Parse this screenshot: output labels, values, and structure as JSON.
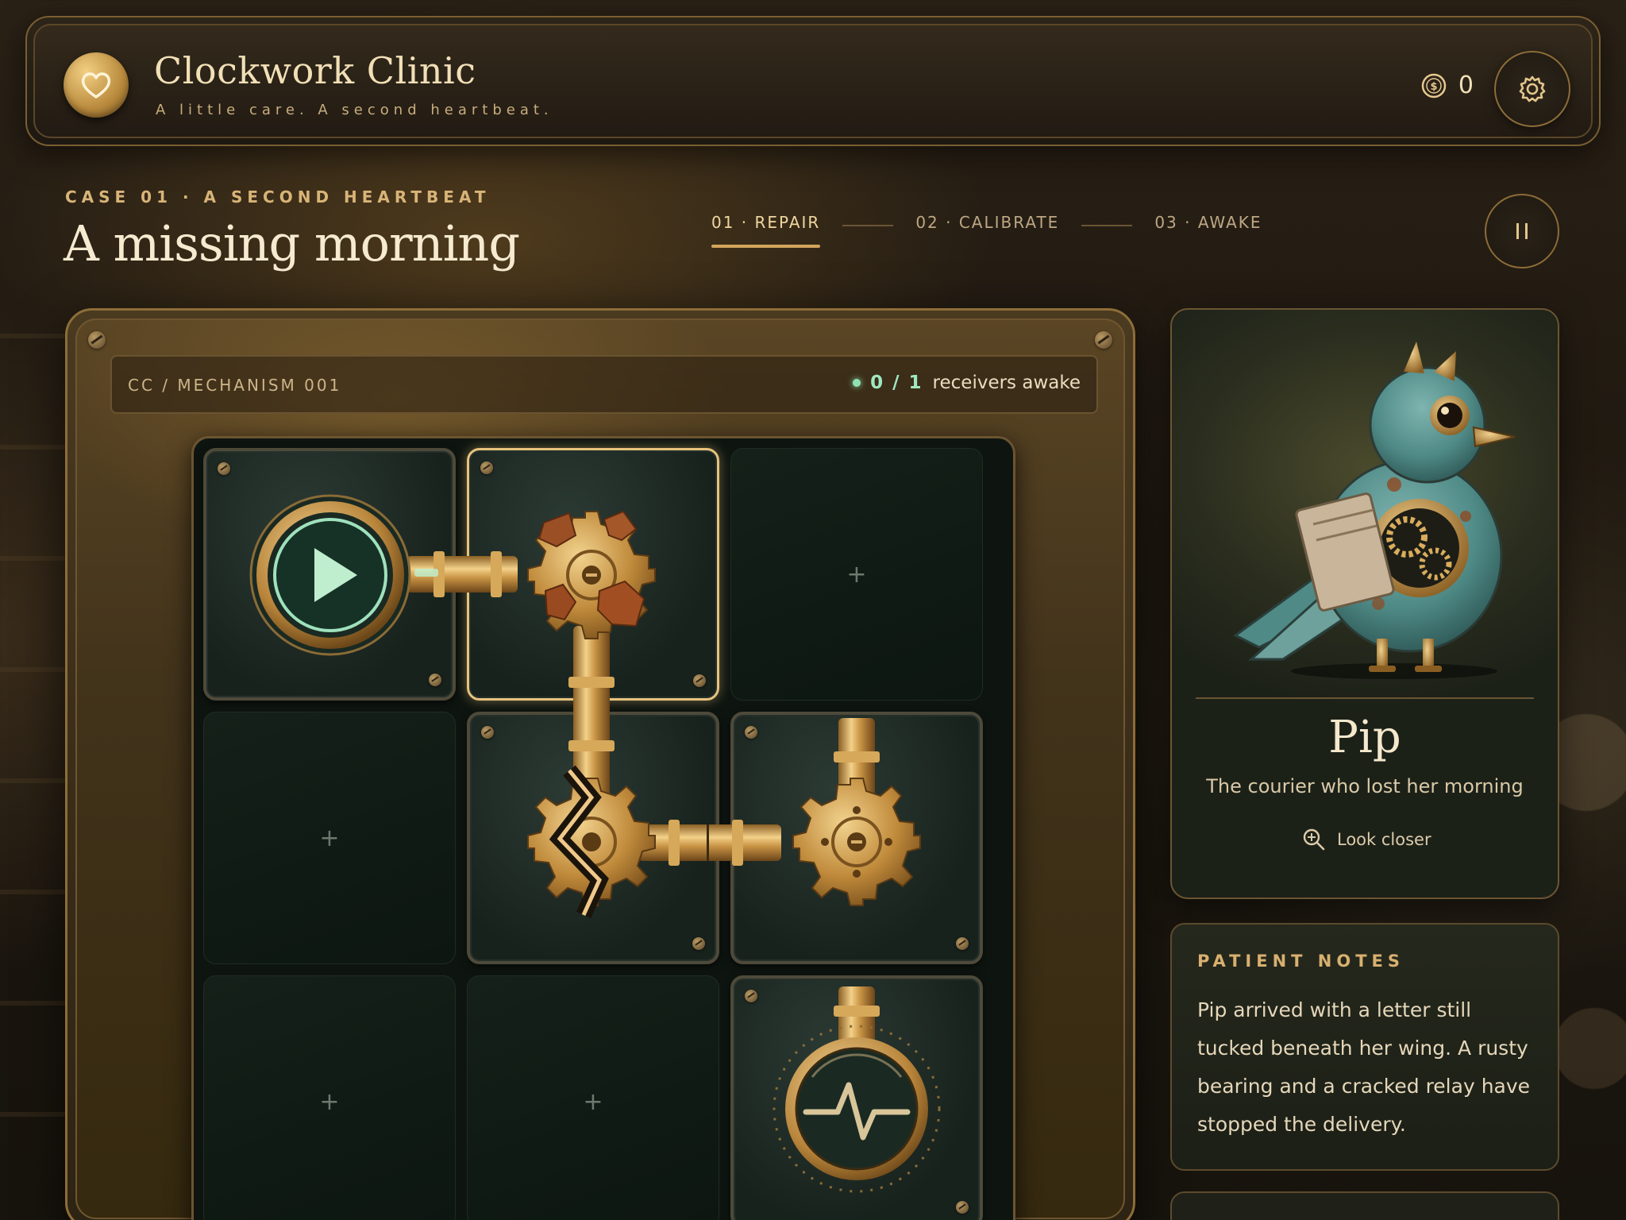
{
  "header": {
    "title": "Clockwork Clinic",
    "subtitle": "A little care. A second heartbeat.",
    "coins": "0",
    "logo_icon": "heart-coin-icon",
    "settings_icon": "gear-icon"
  },
  "case": {
    "label": "CASE 01 · A SECOND HEARTBEAT",
    "title": "A missing morning"
  },
  "steps": [
    {
      "label": "01 · REPAIR",
      "active": true
    },
    {
      "label": "02 · CALIBRATE",
      "active": false
    },
    {
      "label": "03 · AWAKE",
      "active": false
    }
  ],
  "mechanism": {
    "id": "CC / MECHANISM 001",
    "count": "0 / 1",
    "status_text": "receivers awake"
  },
  "grid": {
    "rows": 3,
    "cols": 3,
    "empty_symbol": "+",
    "tiles": [
      {
        "row": 0,
        "col": 0,
        "type": "source",
        "icon": "play-icon"
      },
      {
        "row": 0,
        "col": 1,
        "type": "rusty-gear",
        "selected": true
      },
      {
        "row": 0,
        "col": 2,
        "type": "empty"
      },
      {
        "row": 1,
        "col": 0,
        "type": "empty"
      },
      {
        "row": 1,
        "col": 1,
        "type": "cracked-gear"
      },
      {
        "row": 1,
        "col": 2,
        "type": "gear"
      },
      {
        "row": 2,
        "col": 0,
        "type": "empty"
      },
      {
        "row": 2,
        "col": 1,
        "type": "empty"
      },
      {
        "row": 2,
        "col": 2,
        "type": "receiver",
        "icon": "heartbeat-icon"
      }
    ]
  },
  "patient": {
    "name": "Pip",
    "description": "The courier who lost her morning",
    "look_closer": "Look closer"
  },
  "notes": {
    "title": "PATIENT NOTES",
    "text": "Pip arrived with a letter still tucked beneath her wing. A rusty bearing and a cracked relay have stopped the delivery."
  },
  "colors": {
    "accent": "#d2a55c",
    "brass": "#c99a4a",
    "status_green": "#8fe3b3",
    "board_dark": "#0e1510"
  }
}
